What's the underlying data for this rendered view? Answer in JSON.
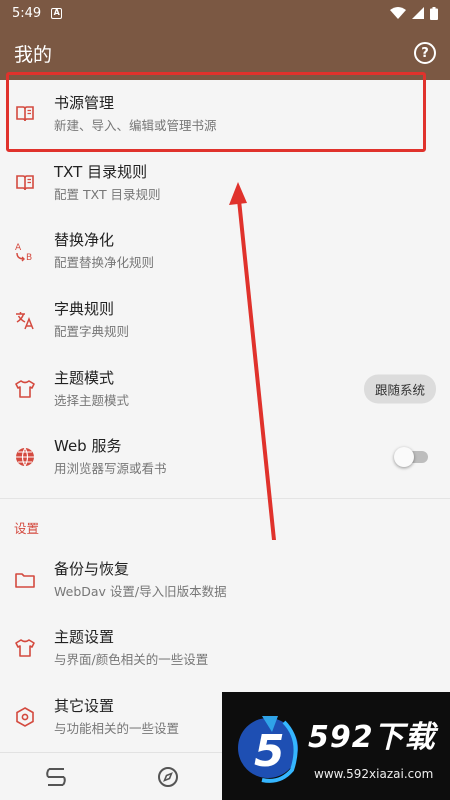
{
  "status_bar": {
    "time": "5:49",
    "notification_icon": "A"
  },
  "app_bar": {
    "title": "我的",
    "help_icon": "?"
  },
  "items_top": [
    {
      "key": "book-source",
      "icon": "book-icon",
      "title": "书源管理",
      "subtitle": "新建、导入、编辑或管理书源"
    },
    {
      "key": "txt-toc",
      "icon": "book-icon",
      "title": "TXT 目录规则",
      "subtitle": "配置 TXT 目录规则"
    },
    {
      "key": "replace",
      "icon": "replace-icon",
      "title": "替换净化",
      "subtitle": "配置替换净化规则"
    },
    {
      "key": "dict",
      "icon": "translate-icon",
      "title": "字典规则",
      "subtitle": "配置字典规则"
    },
    {
      "key": "theme-mode",
      "icon": "shirt-icon",
      "title": "主题模式",
      "subtitle": "选择主题模式",
      "chip": "跟随系统"
    },
    {
      "key": "web",
      "icon": "globe-icon",
      "title": "Web 服务",
      "subtitle": "用浏览器写源或看书",
      "toggle": false
    }
  ],
  "settings_header": "设置",
  "items_settings": [
    {
      "key": "backup",
      "icon": "folder-icon",
      "title": "备份与恢复",
      "subtitle": "WebDav 设置/导入旧版本数据"
    },
    {
      "key": "theme-settings",
      "icon": "shirt-icon",
      "title": "主题设置",
      "subtitle": "与界面/颜色相关的一些设置"
    },
    {
      "key": "other",
      "icon": "hexagon-icon",
      "title": "其它设置",
      "subtitle": "与功能相关的一些设置"
    }
  ],
  "watermark": {
    "brand": "592下载",
    "url": "www.592xiazai.com",
    "logo_digit": "5"
  },
  "colors": {
    "primary": "#7b5843",
    "accent": "#d44a3f",
    "highlight": "#e0322c"
  }
}
